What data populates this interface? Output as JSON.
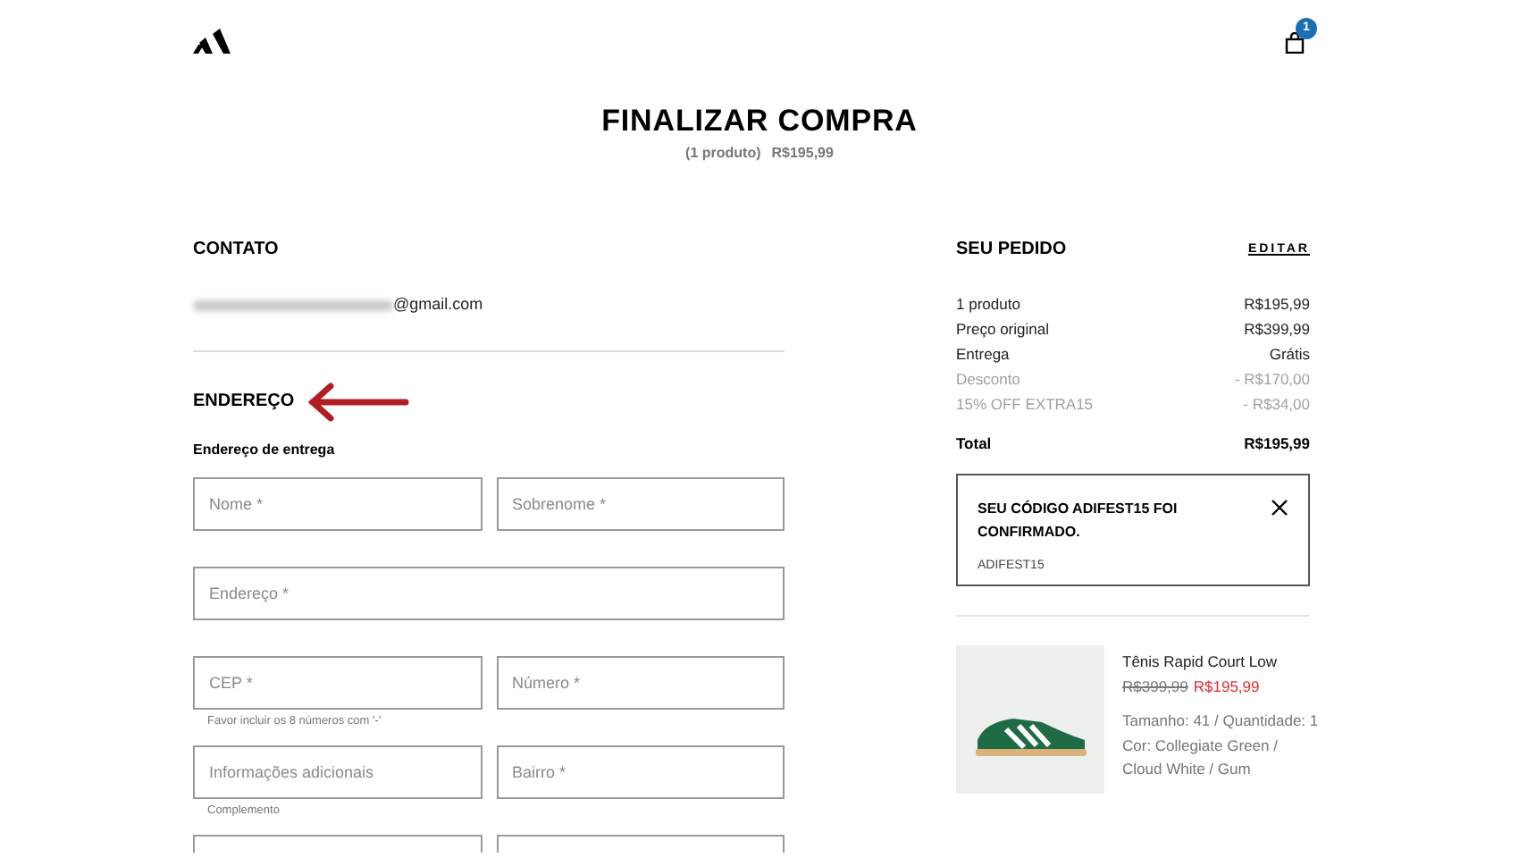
{
  "header": {
    "cart_count": "1"
  },
  "title": "FINALIZAR COMPRA",
  "subtitle": {
    "count": "(1 produto)",
    "price": "R$195,99"
  },
  "contact": {
    "heading": "CONTATO",
    "email_domain": "@gmail.com"
  },
  "address": {
    "heading": "ENDEREÇO",
    "subheading": "Endereço de entrega",
    "field_rows": [
      [
        {
          "placeholder": "Nome *"
        },
        {
          "placeholder": "Sobrenome *"
        }
      ],
      [
        {
          "placeholder": "Endereço *"
        }
      ],
      [
        {
          "placeholder": "CEP *",
          "hint": "Favor incluir os 8 números com '-'"
        },
        {
          "placeholder": "Número *"
        }
      ],
      [
        {
          "placeholder": "Informações adicionais",
          "hint": "Complemento"
        },
        {
          "placeholder": "Bairro *"
        }
      ]
    ]
  },
  "order": {
    "heading": "SEU PEDIDO",
    "edit_link": "EDITAR",
    "lines": [
      {
        "label": "1 produto",
        "value": "R$195,99",
        "muted": false
      },
      {
        "label": "Preço original",
        "value": "R$399,99",
        "muted": false
      },
      {
        "label": "Entrega",
        "value": "Grátis",
        "muted": false
      },
      {
        "label": "Desconto",
        "value": "- R$170,00",
        "muted": true
      },
      {
        "label": "15% OFF EXTRA15",
        "value": "- R$34,00",
        "muted": true
      }
    ],
    "total": {
      "label": "Total",
      "value": "R$195,99"
    },
    "coupon": {
      "message": "SEU CÓDIGO ADIFEST15 FOI CONFIRMADO.",
      "code": "ADIFEST15"
    },
    "product": {
      "name": "Tênis Rapid Court Low",
      "old_price": "R$399,99",
      "price": "R$195,99",
      "size_qty": "Tamanho: 41 / Quantidade: 1",
      "colorway": "Cor: Collegiate Green / Cloud White / Gum"
    }
  }
}
